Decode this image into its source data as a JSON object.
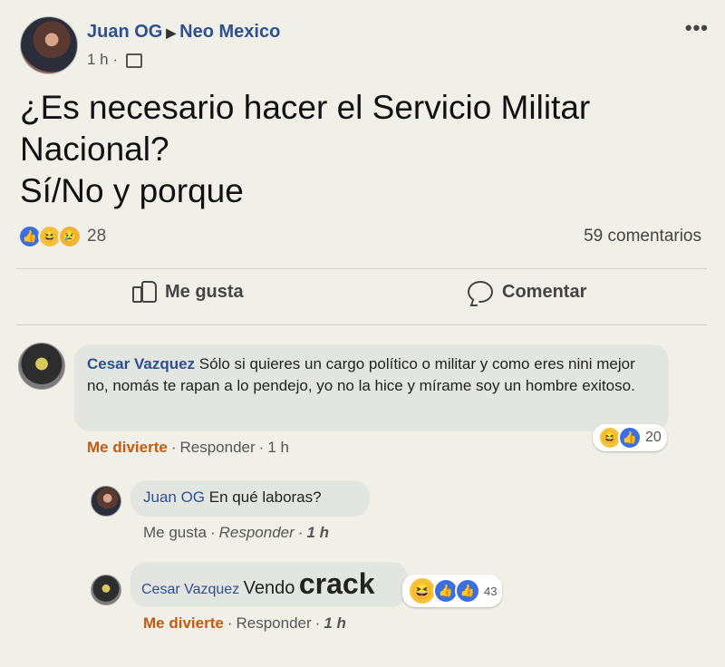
{
  "post": {
    "author": "Juan OG",
    "group": "Neo Mexico",
    "time": "1 h",
    "text_lines": [
      "¿Es necesario hacer el Servicio Militar",
      "Nacional?",
      "Sí/No y porque"
    ],
    "reaction_count": "28",
    "comments_count": "59 comentarios"
  },
  "actions": {
    "like": "Me gusta",
    "comment": "Comentar"
  },
  "comments": [
    {
      "author": "Cesar Vazquez",
      "text": "Sólo si quieres un cargo político o militar y como eres nini mejor no, nomás te rapan a lo pendejo, yo no la hice y mírame soy un hombre exitoso.",
      "reaction_label": "Me divierte",
      "reply_label": "Responder",
      "time": "1 h",
      "reaction_count": "20"
    },
    {
      "author": "Juan OG",
      "text": "En qué laboras?",
      "reaction_label": "Me gusta",
      "reply_label": "Responder",
      "time": "1 h"
    },
    {
      "author": "Cesar Vazquez",
      "text_prefix": "Vendo",
      "text_emph": "crack",
      "reaction_label": "Me divierte",
      "reply_label": "Responder",
      "time": "1 h",
      "reaction_count": "43"
    }
  ],
  "icons": {
    "more": "more-options-icon",
    "privacy": "group-privacy-icon",
    "like": "thumbs-up-icon",
    "comment": "comment-bubble-icon"
  },
  "colors": {
    "link": "#2f4f8f",
    "reacted": "#c45a10",
    "like_blue": "#3b6fe0"
  }
}
